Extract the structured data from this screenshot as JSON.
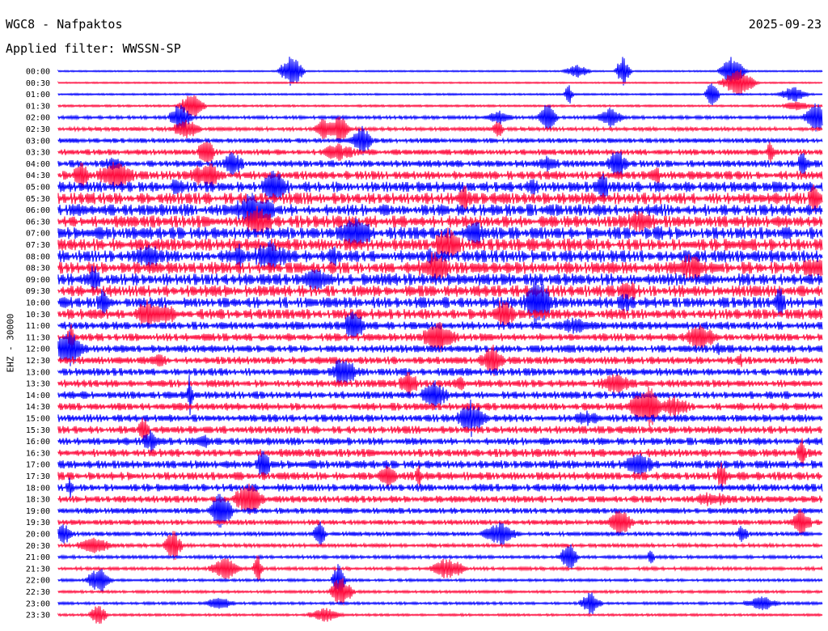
{
  "header": {
    "station": "WGC8 - Nafpaktos",
    "date": "2025-09-23",
    "filter": "Applied filter: WWSSN-SP"
  },
  "channel_label": "EHZ - 30000",
  "colors": {
    "blue": "#0000ff",
    "red": "#ff0a3c"
  },
  "chart_data": {
    "type": "line",
    "title": "WGC8 - Nafpaktos",
    "subtitle": "Applied filter: WWSSN-SP",
    "date": "2025-09-23",
    "ylabel": "EHZ - 30000",
    "xlabel": "",
    "row_duration_minutes": 30,
    "trace_colors": [
      "#0000ff",
      "#ff0a3c"
    ],
    "row_labels": [
      "00:00",
      "00:30",
      "01:00",
      "01:30",
      "02:00",
      "02:30",
      "03:00",
      "03:30",
      "04:00",
      "04:30",
      "05:00",
      "05:30",
      "06:00",
      "06:30",
      "07:00",
      "07:30",
      "08:00",
      "08:30",
      "09:00",
      "09:30",
      "10:00",
      "10:30",
      "11:00",
      "11:30",
      "12:00",
      "12:30",
      "13:00",
      "13:30",
      "14:00",
      "14:30",
      "15:00",
      "15:30",
      "16:00",
      "16:30",
      "17:00",
      "17:30",
      "18:00",
      "18:30",
      "19:00",
      "19:30",
      "20:00",
      "20:30",
      "21:00",
      "21:30",
      "22:00",
      "22:30",
      "23:00",
      "23:30"
    ],
    "noise_level": [
      0.1,
      0.1,
      0.15,
      0.2,
      0.4,
      0.5,
      0.7,
      0.9,
      1.1,
      1.4,
      1.7,
      1.9,
      2.0,
      2.0,
      2.0,
      2.0,
      2.0,
      2.0,
      2.0,
      1.9,
      1.8,
      1.7,
      1.3,
      1.2,
      1.2,
      1.2,
      1.2,
      1.2,
      1.2,
      1.2,
      1.2,
      1.2,
      1.2,
      1.3,
      1.3,
      1.3,
      1.2,
      1.1,
      0.9,
      0.8,
      0.6,
      0.5,
      0.4,
      0.4,
      0.3,
      0.3,
      0.3,
      0.25
    ],
    "grid": false,
    "legend": "none"
  }
}
